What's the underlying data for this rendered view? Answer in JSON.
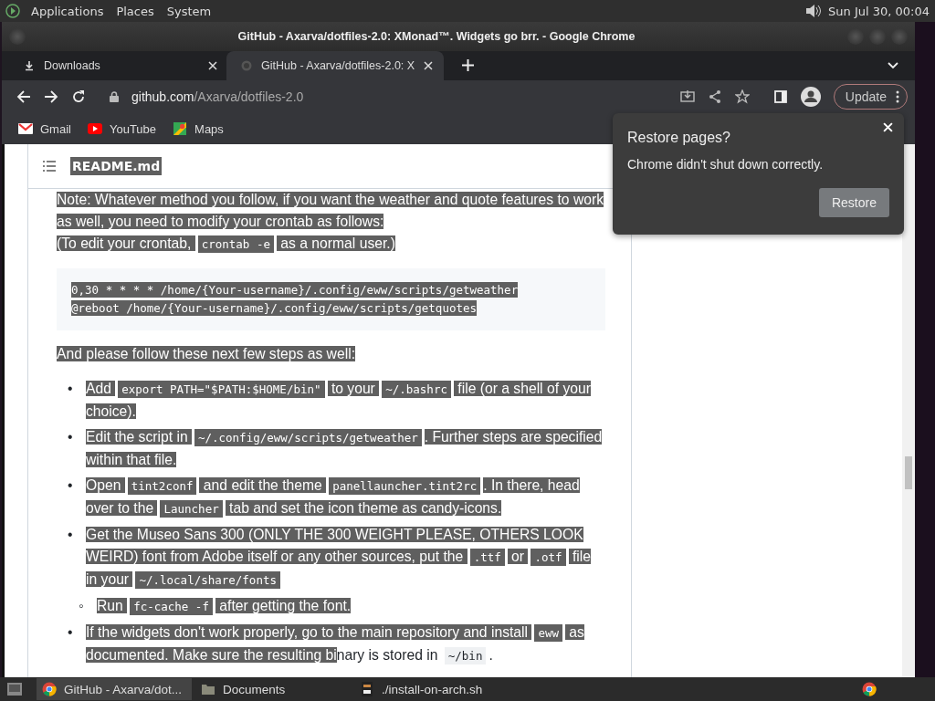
{
  "top_panel": {
    "menus": [
      "Applications",
      "Places",
      "System"
    ],
    "clock": "Sun Jul 30, 00:04"
  },
  "window": {
    "title": "GitHub - Axarva/dotfiles-2.0: XMonad™. Widgets go brr. - Google Chrome"
  },
  "tabs": [
    {
      "label": "Downloads",
      "kind": "download",
      "selected": false
    },
    {
      "label": "GitHub - Axarva/dotfiles-2.0: X",
      "kind": "github",
      "selected": true
    }
  ],
  "toolbar": {
    "url_domain": "github.com",
    "url_path": "/Axarva/dotfiles-2.0",
    "update_label": "Update"
  },
  "bookmarks": [
    {
      "label": "Gmail",
      "kind": "gmail"
    },
    {
      "label": "YouTube",
      "kind": "youtube"
    },
    {
      "label": "Maps",
      "kind": "maps"
    }
  ],
  "readme_header": {
    "title": "README.md"
  },
  "content": [
    {
      "kind": "paragraph",
      "segments": [
        {
          "kind": "text",
          "text": "Note: Whatever method you follow, if you want the weather and quote features to work as well, you need to modify your crontab as follows:",
          "selected": true
        },
        {
          "kind": "break"
        },
        {
          "kind": "text",
          "text": "(To edit your crontab, ",
          "selected": true
        },
        {
          "kind": "code",
          "text": "crontab -e",
          "selected": true
        },
        {
          "kind": "text",
          "text": " as a normal user.)",
          "selected": true
        }
      ]
    },
    {
      "kind": "code_block",
      "lines": [
        {
          "text": "0,30 * * * * /home/{Your-username}/.config/eww/scripts/getweather",
          "selected": true
        },
        {
          "text": "@reboot /home/{Your-username}/.config/eww/scripts/getquotes",
          "selected": true
        }
      ]
    },
    {
      "kind": "paragraph",
      "segments": [
        {
          "kind": "text",
          "text": "And please follow these next few steps as well:",
          "selected": true
        }
      ]
    },
    {
      "kind": "list",
      "items": [
        {
          "marker": "•",
          "segments": [
            {
              "kind": "text",
              "text": "Add ",
              "selected": true
            },
            {
              "kind": "code",
              "text": "export PATH=\"$PATH:$HOME/bin\"",
              "selected": true
            },
            {
              "kind": "text",
              "text": " to your ",
              "selected": true
            },
            {
              "kind": "code",
              "text": "~/.bashrc",
              "selected": true
            },
            {
              "kind": "text",
              "text": " file (or a shell of your choice).",
              "selected": true
            }
          ]
        },
        {
          "marker": "•",
          "segments": [
            {
              "kind": "text",
              "text": "Edit the script in ",
              "selected": true
            },
            {
              "kind": "code",
              "text": "~/.config/eww/scripts/getweather",
              "selected": true
            },
            {
              "kind": "text",
              "text": ". Further steps are specified within that file.",
              "selected": true
            }
          ]
        },
        {
          "marker": "•",
          "segments": [
            {
              "kind": "text",
              "text": "Open ",
              "selected": true
            },
            {
              "kind": "code",
              "text": "tint2conf",
              "selected": true
            },
            {
              "kind": "text",
              "text": " and edit the theme ",
              "selected": true
            },
            {
              "kind": "code",
              "text": "panellauncher.tint2rc",
              "selected": true
            },
            {
              "kind": "text",
              "text": ". In there, head over to the ",
              "selected": true
            },
            {
              "kind": "code",
              "text": "Launcher",
              "selected": true
            },
            {
              "kind": "text",
              "text": " tab and set the icon theme as candy-icons.",
              "selected": true
            }
          ]
        },
        {
          "marker": "•",
          "segments": [
            {
              "kind": "text",
              "text": "Get the Museo Sans 300 (ONLY THE 300 WEIGHT PLEASE, OTHERS LOOK WEIRD) font from Adobe itself or any other sources, put the ",
              "selected": true
            },
            {
              "kind": "code",
              "text": ".ttf",
              "selected": true
            },
            {
              "kind": "text",
              "text": " or ",
              "selected": true
            },
            {
              "kind": "code",
              "text": ".otf",
              "selected": true
            },
            {
              "kind": "text",
              "text": " file in your ",
              "selected": true
            },
            {
              "kind": "code",
              "text": "~/.local/share/fonts",
              "selected": true
            }
          ],
          "children": [
            {
              "marker": "◦",
              "segments": [
                {
                  "kind": "text",
                  "text": "Run ",
                  "selected": true
                },
                {
                  "kind": "code",
                  "text": "fc-cache -f",
                  "selected": true
                },
                {
                  "kind": "text",
                  "text": " after getting the font.",
                  "selected": true
                }
              ]
            }
          ]
        },
        {
          "marker": "•",
          "segments": [
            {
              "kind": "text",
              "text": "If the widgets don't work properly, go to the main repository and install ",
              "selected": true
            },
            {
              "kind": "code",
              "text": "eww",
              "selected": true
            },
            {
              "kind": "text",
              "text": " as documented. Make sure the resulting bi",
              "selected": true
            },
            {
              "kind": "text",
              "text": "nary is stored in ",
              "selected": false
            },
            {
              "kind": "code",
              "text": "~/bin",
              "selected": false
            },
            {
              "kind": "text",
              "text": ".",
              "selected": false
            }
          ]
        }
      ]
    }
  ],
  "restore_dialog": {
    "title": "Restore pages?",
    "message": "Chrome didn't shut down correctly.",
    "button": "Restore"
  },
  "taskbar": {
    "items": [
      {
        "label": "GitHub - Axarva/dot...",
        "kind": "chrome",
        "selected": true
      },
      {
        "label": "Documents",
        "kind": "folder",
        "selected": false
      },
      {
        "label": "./install-on-arch.sh",
        "kind": "terminal",
        "selected": false
      }
    ]
  }
}
